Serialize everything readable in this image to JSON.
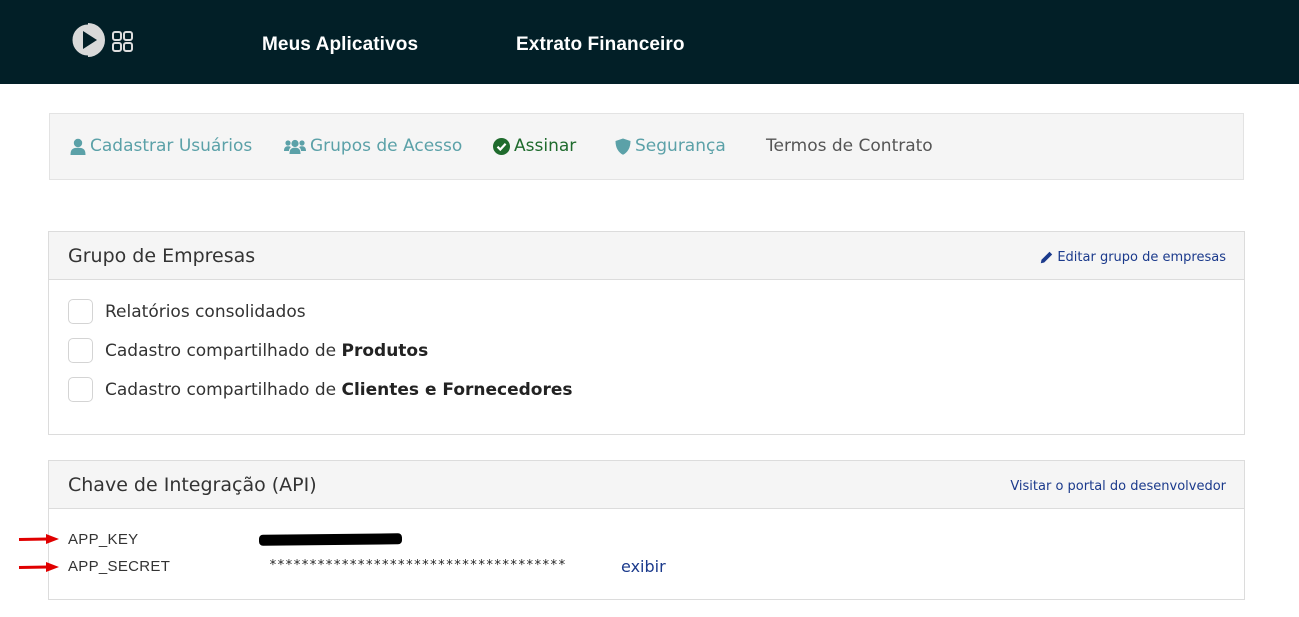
{
  "topbar": {
    "nav": [
      "Meus Aplicativos",
      "Extrato Financeiro"
    ],
    "logo_icon": "play-circle-icon",
    "apps_icon": "grid-apps-icon",
    "background": "#021f27"
  },
  "tabs": [
    {
      "label": "Cadastrar Usuários",
      "icon": "user-icon"
    },
    {
      "label": "Grupos de Acesso",
      "icon": "users-icon"
    },
    {
      "label": "Assinar",
      "icon": "check-circle-icon"
    },
    {
      "label": "Segurança",
      "icon": "shield-icon"
    },
    {
      "label": "Termos de Contrato"
    }
  ],
  "grupo_empresas": {
    "title": "Grupo de Empresas",
    "edit_link": "Editar grupo de empresas",
    "options": [
      {
        "text": "Relatórios consolidados",
        "bold": "",
        "checked": false
      },
      {
        "text": "Cadastro compartilhado de ",
        "bold": "Produtos",
        "checked": false
      },
      {
        "text": "Cadastro compartilhado de ",
        "bold": "Clientes e Fornecedores",
        "checked": false
      }
    ]
  },
  "api": {
    "title": "Chave de Integração (API)",
    "portal_link": "Visitar o portal do desenvolvedor",
    "app_key_label": "APP_KEY",
    "app_secret_label": "APP_SECRET",
    "app_secret_mask": "*************************************",
    "show_link": "exibir"
  },
  "colors": {
    "accent": "#5ba1a8",
    "assinar": "#1f6b2d",
    "link": "#1b3a8c",
    "annotation_arrow": "#e00000"
  }
}
